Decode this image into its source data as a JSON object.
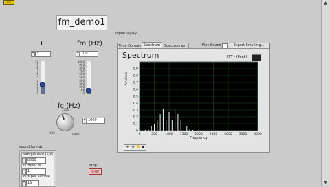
{
  "toolbar": {
    "run_label": "Run"
  },
  "title": "fm_demo1",
  "controls": {
    "i": {
      "label": "I",
      "value": "3",
      "ticks": [
        "10",
        "9",
        "8",
        "7",
        "6",
        "5",
        "4",
        "3",
        "2",
        "1",
        "0"
      ],
      "level_fraction": 0.3
    },
    "fm": {
      "label": "fm (Hz)",
      "value": "100",
      "ticks": [
        "1000",
        "900",
        "800",
        "700",
        "600",
        "500",
        "400",
        "300",
        "200",
        "100",
        "0"
      ],
      "level_fraction": 0.1
    },
    "fc": {
      "label": "fc (Hz)",
      "value": "1000",
      "knob_max": "1000",
      "knob_min_left": "100",
      "knob_max_right": "10000"
    }
  },
  "tabs": {
    "label": "TripleDisplay",
    "items": [
      {
        "label": "Time Domain"
      },
      {
        "label": "Spectrum"
      },
      {
        "label": "Spectrogram"
      }
    ],
    "selected": "Spectrum"
  },
  "spectrum": {
    "title": "Spectrum",
    "legend": "FFT - (Peak)",
    "xlabel": "Frequency",
    "ylabel": "Amplitude",
    "xticks": [
      "0",
      "500",
      "1000",
      "1500",
      "2000",
      "2500",
      "3000",
      "3500",
      "4000"
    ],
    "yticks": [
      "1",
      "0.9",
      "0.8",
      "0.7",
      "0.6",
      "0.5",
      "0.4",
      "0.3",
      "0.2",
      "0.1",
      "0"
    ]
  },
  "play_sound": {
    "label": "Play Sound"
  },
  "export_button": {
    "label": "Export Snip Img..."
  },
  "sound_format": {
    "label": "sound format",
    "sample_rate_label": "sample rate (S/s)",
    "sample_rate_value": "8000",
    "channels_label": "number of channels",
    "channels_value": "1",
    "bits_label": "bits per sample",
    "bits_value": "16"
  },
  "stop_button": {
    "caption": "stop",
    "label": "STOP"
  },
  "chart_data": {
    "type": "bar",
    "title": "Spectrum",
    "xlabel": "Frequency",
    "ylabel": "Amplitude",
    "xlim": [
      0,
      4000
    ],
    "ylim": [
      0,
      1
    ],
    "grid": true,
    "x": [
      200,
      300,
      400,
      500,
      600,
      700,
      800,
      900,
      1000,
      1100,
      1200,
      1300,
      1400,
      1500,
      1600,
      1700,
      1800
    ],
    "values": [
      0.01,
      0.03,
      0.06,
      0.1,
      0.16,
      0.24,
      0.31,
      0.16,
      0.27,
      0.16,
      0.31,
      0.24,
      0.16,
      0.1,
      0.06,
      0.03,
      0.01
    ]
  }
}
